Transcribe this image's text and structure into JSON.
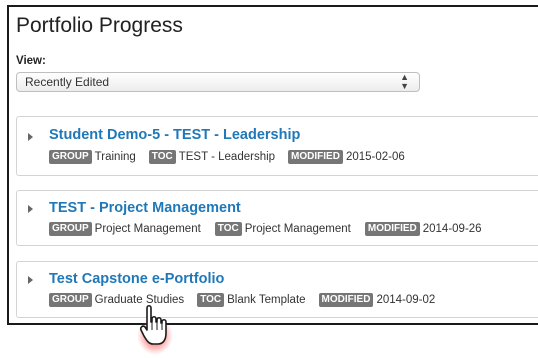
{
  "page": {
    "title": "Portfolio Progress",
    "view_label": "View:",
    "view_select": {
      "value": "Recently Edited",
      "icon": "updown-arrows-icon"
    }
  },
  "badges": {
    "group": "GROUP",
    "toc": "TOC",
    "modified": "MODIFIED"
  },
  "portfolios": [
    {
      "name": "Student Demo-5 - TEST - Leadership",
      "group": "Training",
      "toc": "TEST - Leadership",
      "modified": "2015-02-06"
    },
    {
      "name": "TEST - Project Management",
      "group": "Project Management",
      "toc": "Project Management",
      "modified": "2014-09-26"
    },
    {
      "name": "Test Capstone e-Portfolio",
      "group": "Graduate Studies",
      "toc": "Blank Template",
      "modified": "2014-09-02"
    }
  ],
  "colors": {
    "link": "#1f78b8",
    "badge": "#767676",
    "cursor_glow": "#e8101a"
  }
}
